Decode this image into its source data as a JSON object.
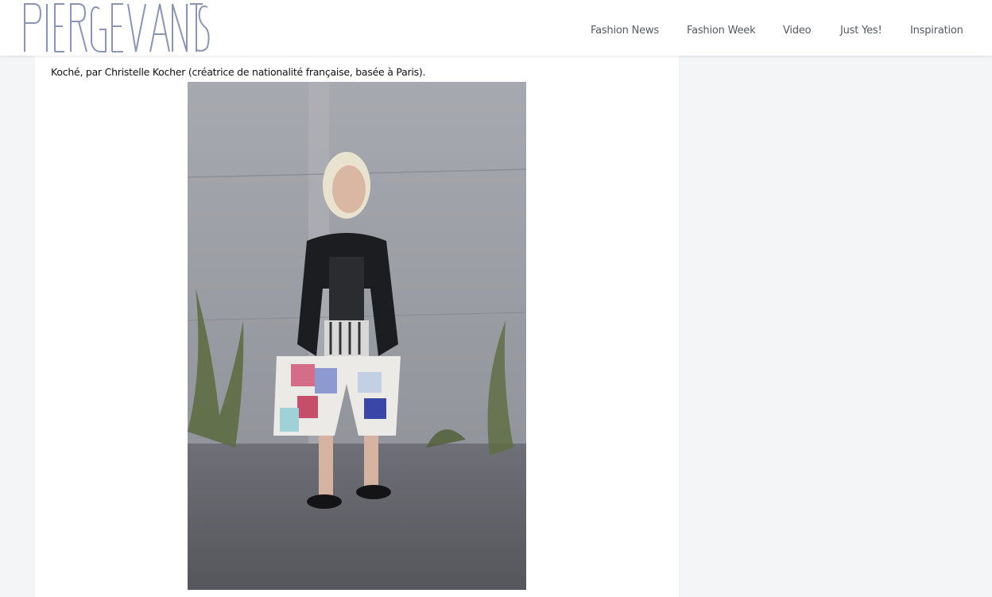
{
  "site": {
    "logo_alt": "PIERGEV ANTIS logo"
  },
  "nav": {
    "items": [
      {
        "label": "Fashion News"
      },
      {
        "label": "Fashion Week"
      },
      {
        "label": "Video"
      },
      {
        "label": "Just Yes!"
      },
      {
        "label": "Inspiration"
      }
    ]
  },
  "article": {
    "caption": "Koché, par Christelle Kocher (créatrice de nationalité française, basée à Paris)."
  },
  "colors": {
    "logo": "#8a93b8",
    "header_bg": "#ffffff",
    "page_bg": "#f4f5f7",
    "nav_text": "#555a60"
  }
}
